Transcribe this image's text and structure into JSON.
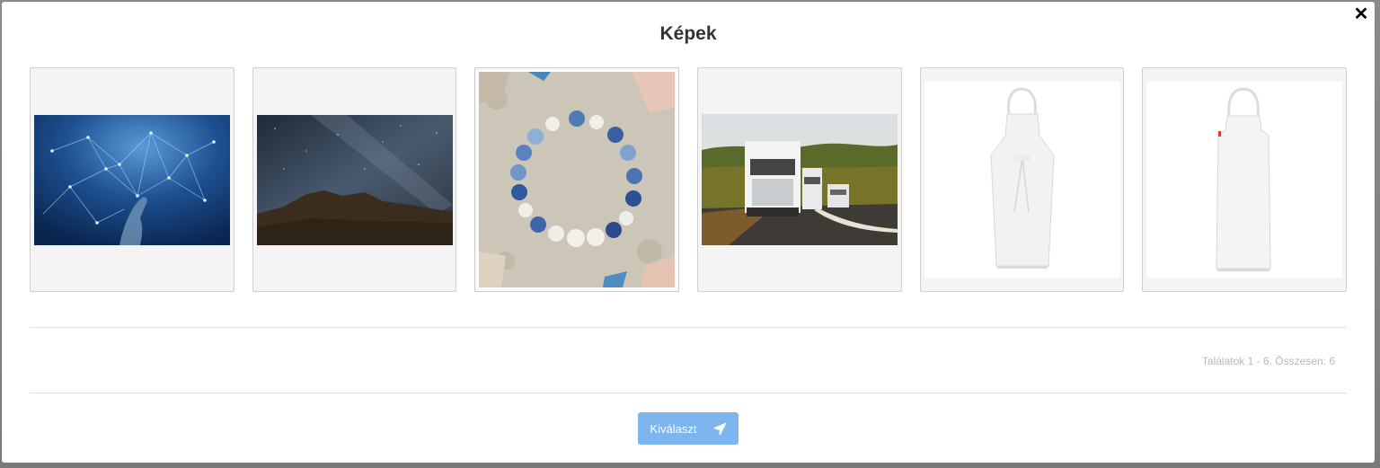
{
  "modal": {
    "title": "Képek",
    "close_symbol": "✕",
    "results_text": "Találatok 1 - 6. Összesen: 6",
    "select_label": "Kiválaszt",
    "select_icon": "paper-plane-icon"
  },
  "images": [
    {
      "name": "network-hand-image"
    },
    {
      "name": "night-sky-image"
    },
    {
      "name": "bracelet-sand-image"
    },
    {
      "name": "trucks-road-image"
    },
    {
      "name": "white-apron-front-image"
    },
    {
      "name": "white-apron-image"
    }
  ],
  "colors": {
    "accent_button": "#7db6ee",
    "backdrop": "#7d7d7d"
  }
}
